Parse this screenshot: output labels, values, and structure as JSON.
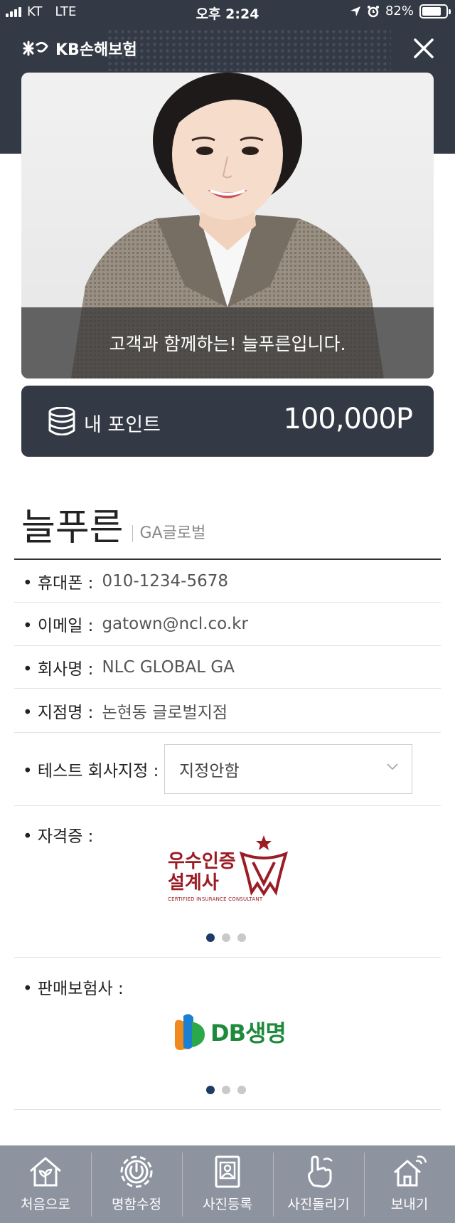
{
  "status_bar": {
    "carrier": "KT",
    "network": "LTE",
    "time": "오후 2:24",
    "battery": "82%",
    "battery_level": 0.82
  },
  "header": {
    "brand": "KB손해보험"
  },
  "hero": {
    "caption": "고객과 함께하는! 늘푸른입니다."
  },
  "points": {
    "label": "내 포인트",
    "value": "100,000P"
  },
  "profile": {
    "name": "늘푸른",
    "org": "GA글로벌",
    "fields": [
      {
        "label": "휴대폰 :",
        "value": "010-1234-5678"
      },
      {
        "label": "이메일 :",
        "value": "gatown@ncl.co.kr"
      },
      {
        "label": "회사명 :",
        "value": "NLC GLOBAL GA"
      },
      {
        "label": "지점명 :",
        "value": "논현동 글로벌지점"
      }
    ],
    "test_company": {
      "label": "테스트 회사지정 :",
      "selected": "지정안함"
    }
  },
  "certificates": {
    "label": "자격증 :",
    "logo_line1": "우수인증",
    "logo_line2": "설계사",
    "logo_sub": "CERTIFIED INSURANCE CONSULTANT"
  },
  "insurers": {
    "label": "판매보험사 :",
    "logo_text": "DB생명"
  },
  "colors": {
    "header_bg": "#333945",
    "nav_bg": "#8e93a0",
    "cert_red": "#9b1c24",
    "db_green": "#1e8a3c",
    "dot_active": "#1f3a66"
  },
  "bottom_nav": [
    {
      "label": "처음으로",
      "icon": "home-sprout-icon"
    },
    {
      "label": "명함수정",
      "icon": "gear-icon"
    },
    {
      "label": "사진등록",
      "icon": "id-photo-icon"
    },
    {
      "label": "사진돌리기",
      "icon": "swipe-hand-icon"
    },
    {
      "label": "보내기",
      "icon": "home-send-icon"
    }
  ]
}
